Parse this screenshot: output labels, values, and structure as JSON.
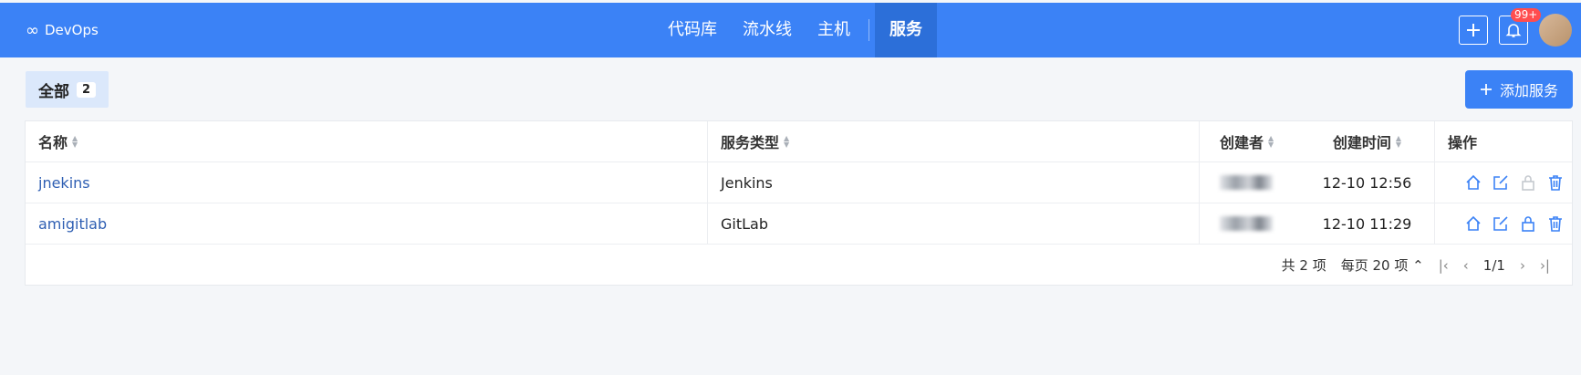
{
  "header": {
    "brand": "DevOps",
    "nav": [
      {
        "label": "代码库",
        "active": false
      },
      {
        "label": "流水线",
        "active": false
      },
      {
        "label": "主机",
        "active": false
      },
      {
        "label": "服务",
        "active": true
      }
    ],
    "notification_badge": "99+"
  },
  "toolbar": {
    "filter_label": "全部",
    "filter_count": "2",
    "add_button": "添加服务"
  },
  "table": {
    "columns": [
      "名称",
      "服务类型",
      "创建者",
      "创建时间",
      "操作"
    ],
    "rows": [
      {
        "name": "jnekins",
        "type": "Jenkins",
        "time": "12-10 12:56"
      },
      {
        "name": "amigitlab",
        "type": "GitLab",
        "time": "12-10 11:29"
      }
    ]
  },
  "pagination": {
    "total": "共 2 项",
    "per_page": "每页 20 项",
    "page": "1/1"
  },
  "colors": {
    "primary": "#3b82f6",
    "link": "#2f5fb3",
    "icon_blue": "#3b82f6",
    "icon_disabled": "#c5c9cf"
  }
}
